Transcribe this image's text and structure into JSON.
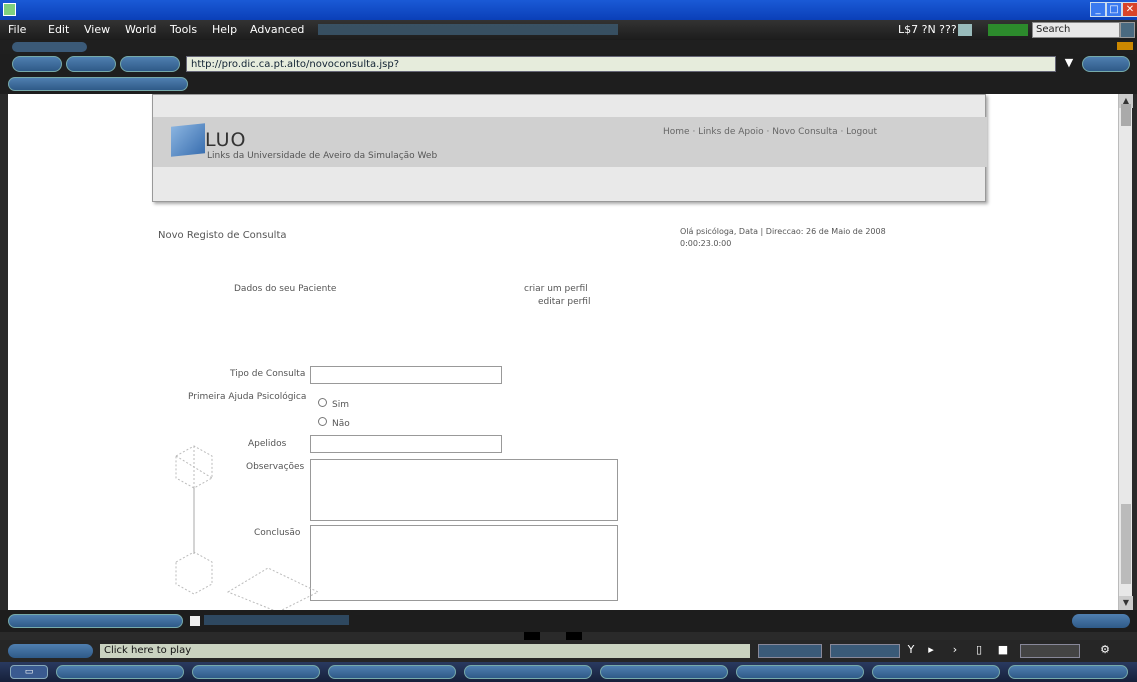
{
  "window": {
    "title": "",
    "min": "_",
    "max": "□",
    "close": "✕"
  },
  "menu": {
    "items": [
      "File",
      "Edit",
      "View",
      "World",
      "Tools",
      "Help",
      "Advanced"
    ],
    "status": "L$7 ?N ???",
    "search_label": "Search"
  },
  "nav": {
    "url": "http://pro.dic.ca.pt.alto/novoconsulta.jsp?",
    "go": "▼"
  },
  "header": {
    "logo": "LUO",
    "logo_sub": "Links da Universidade de Aveiro da Simulação Web",
    "links": "Home · Links de Apoio · Novo Consulta · Logout"
  },
  "page": {
    "title": "Novo Registo de Consulta",
    "date": "Olá psicóloga, Data | Direccao: 26 de Maio de 2008",
    "time": "0:00:23.0:00",
    "patient_label": "Dados do seu Paciente",
    "patient_links": [
      "criar um perfil",
      "editar perfil"
    ],
    "form": {
      "tipo_label": "Tipo de Consulta",
      "primeira_label": "Primeira Ajuda Psicológica",
      "sim": "Sim",
      "nao": "Não",
      "apelidos_label": "Apelidos",
      "observacoes_label": "Observações",
      "conclusao_label": "Conclusão"
    }
  },
  "statusbar": {
    "click_here": "Click here to play"
  }
}
